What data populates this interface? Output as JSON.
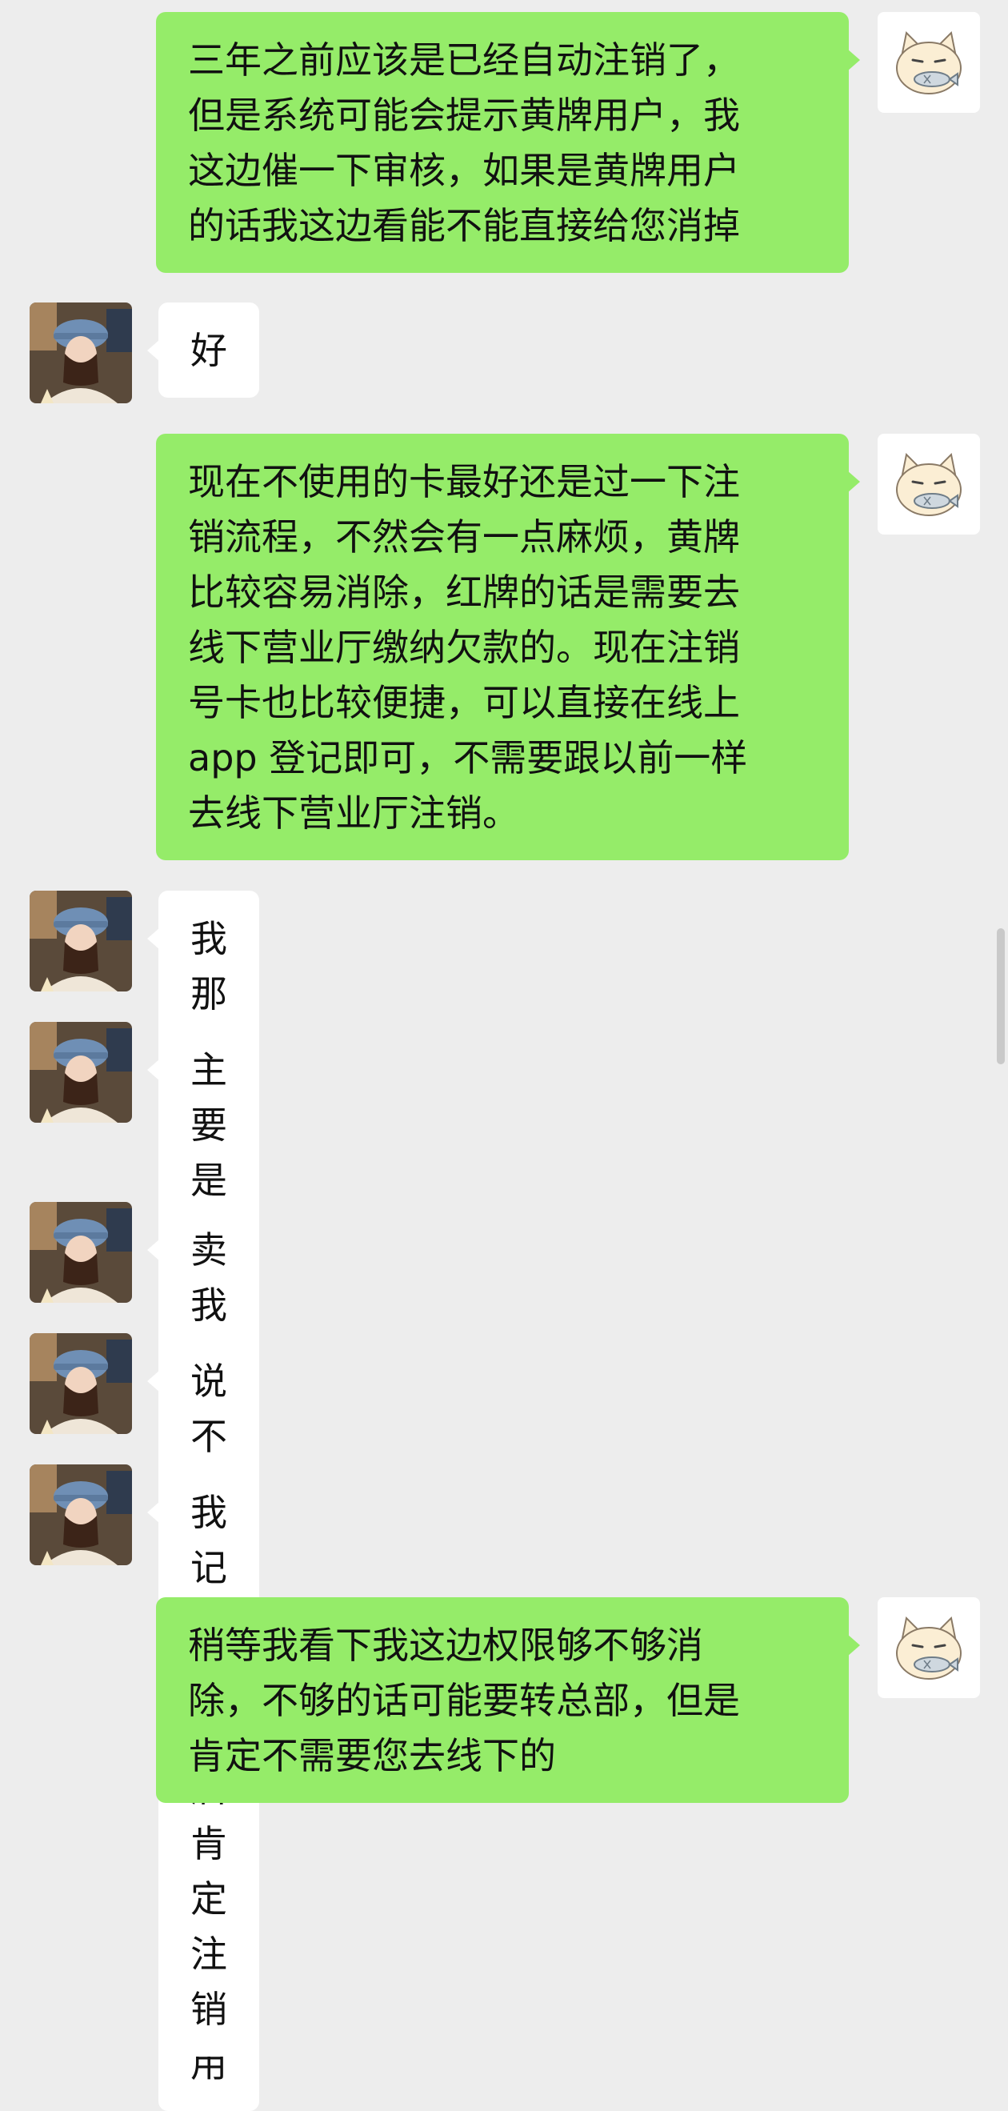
{
  "chat": {
    "messages": [
      {
        "sender": "agent",
        "avatar_icon": "cat-fish-sticker-icon",
        "text": "三年之前应该是已经自动注销了，\n但是系统可能会提示黄牌用户，我\n这边催一下审核，如果是黄牌用户\n的话我这边看能不能直接给您消掉"
      },
      {
        "sender": "user",
        "avatar_icon": "user-photo-icon",
        "text": "好"
      },
      {
        "sender": "agent",
        "avatar_icon": "cat-fish-sticker-icon",
        "text": "现在不使用的卡最好还是过一下注\n销流程，不然会有一点麻烦，黄牌\n比较容易消除，红牌的话是需要去\n线下营业厅缴纳欠款的。现在注销\n号卡也比较便捷，可以直接在线上\napp 登记即可，不需要跟以前一样\n去线下营业厅注销。"
      },
      {
        "sender": "user",
        "avatar_icon": "user-photo-icon",
        "text": "我那个还用吗"
      },
      {
        "sender": "user",
        "avatar_icon": "user-photo-icon",
        "text": "主要是我之前想注销来着 那个买\n我的说不用"
      },
      {
        "sender": "user",
        "avatar_icon": "user-photo-icon",
        "text": "卖我的人"
      },
      {
        "sender": "user",
        "avatar_icon": "user-photo-icon",
        "text": "说不用"
      },
      {
        "sender": "user",
        "avatar_icon": "user-photo-icon",
        "text": "我记住了以后肯定注销"
      },
      {
        "sender": "agent",
        "avatar_icon": "cat-fish-sticker-icon",
        "text": "稍等我看下我这边权限够不够消\n除，不够的话可能要转总部，但是\n肯定不需要您去线下的"
      }
    ]
  },
  "colors": {
    "background": "#ededed",
    "outgoing_bubble": "#95ec69",
    "incoming_bubble": "#ffffff",
    "text": "#111111"
  }
}
